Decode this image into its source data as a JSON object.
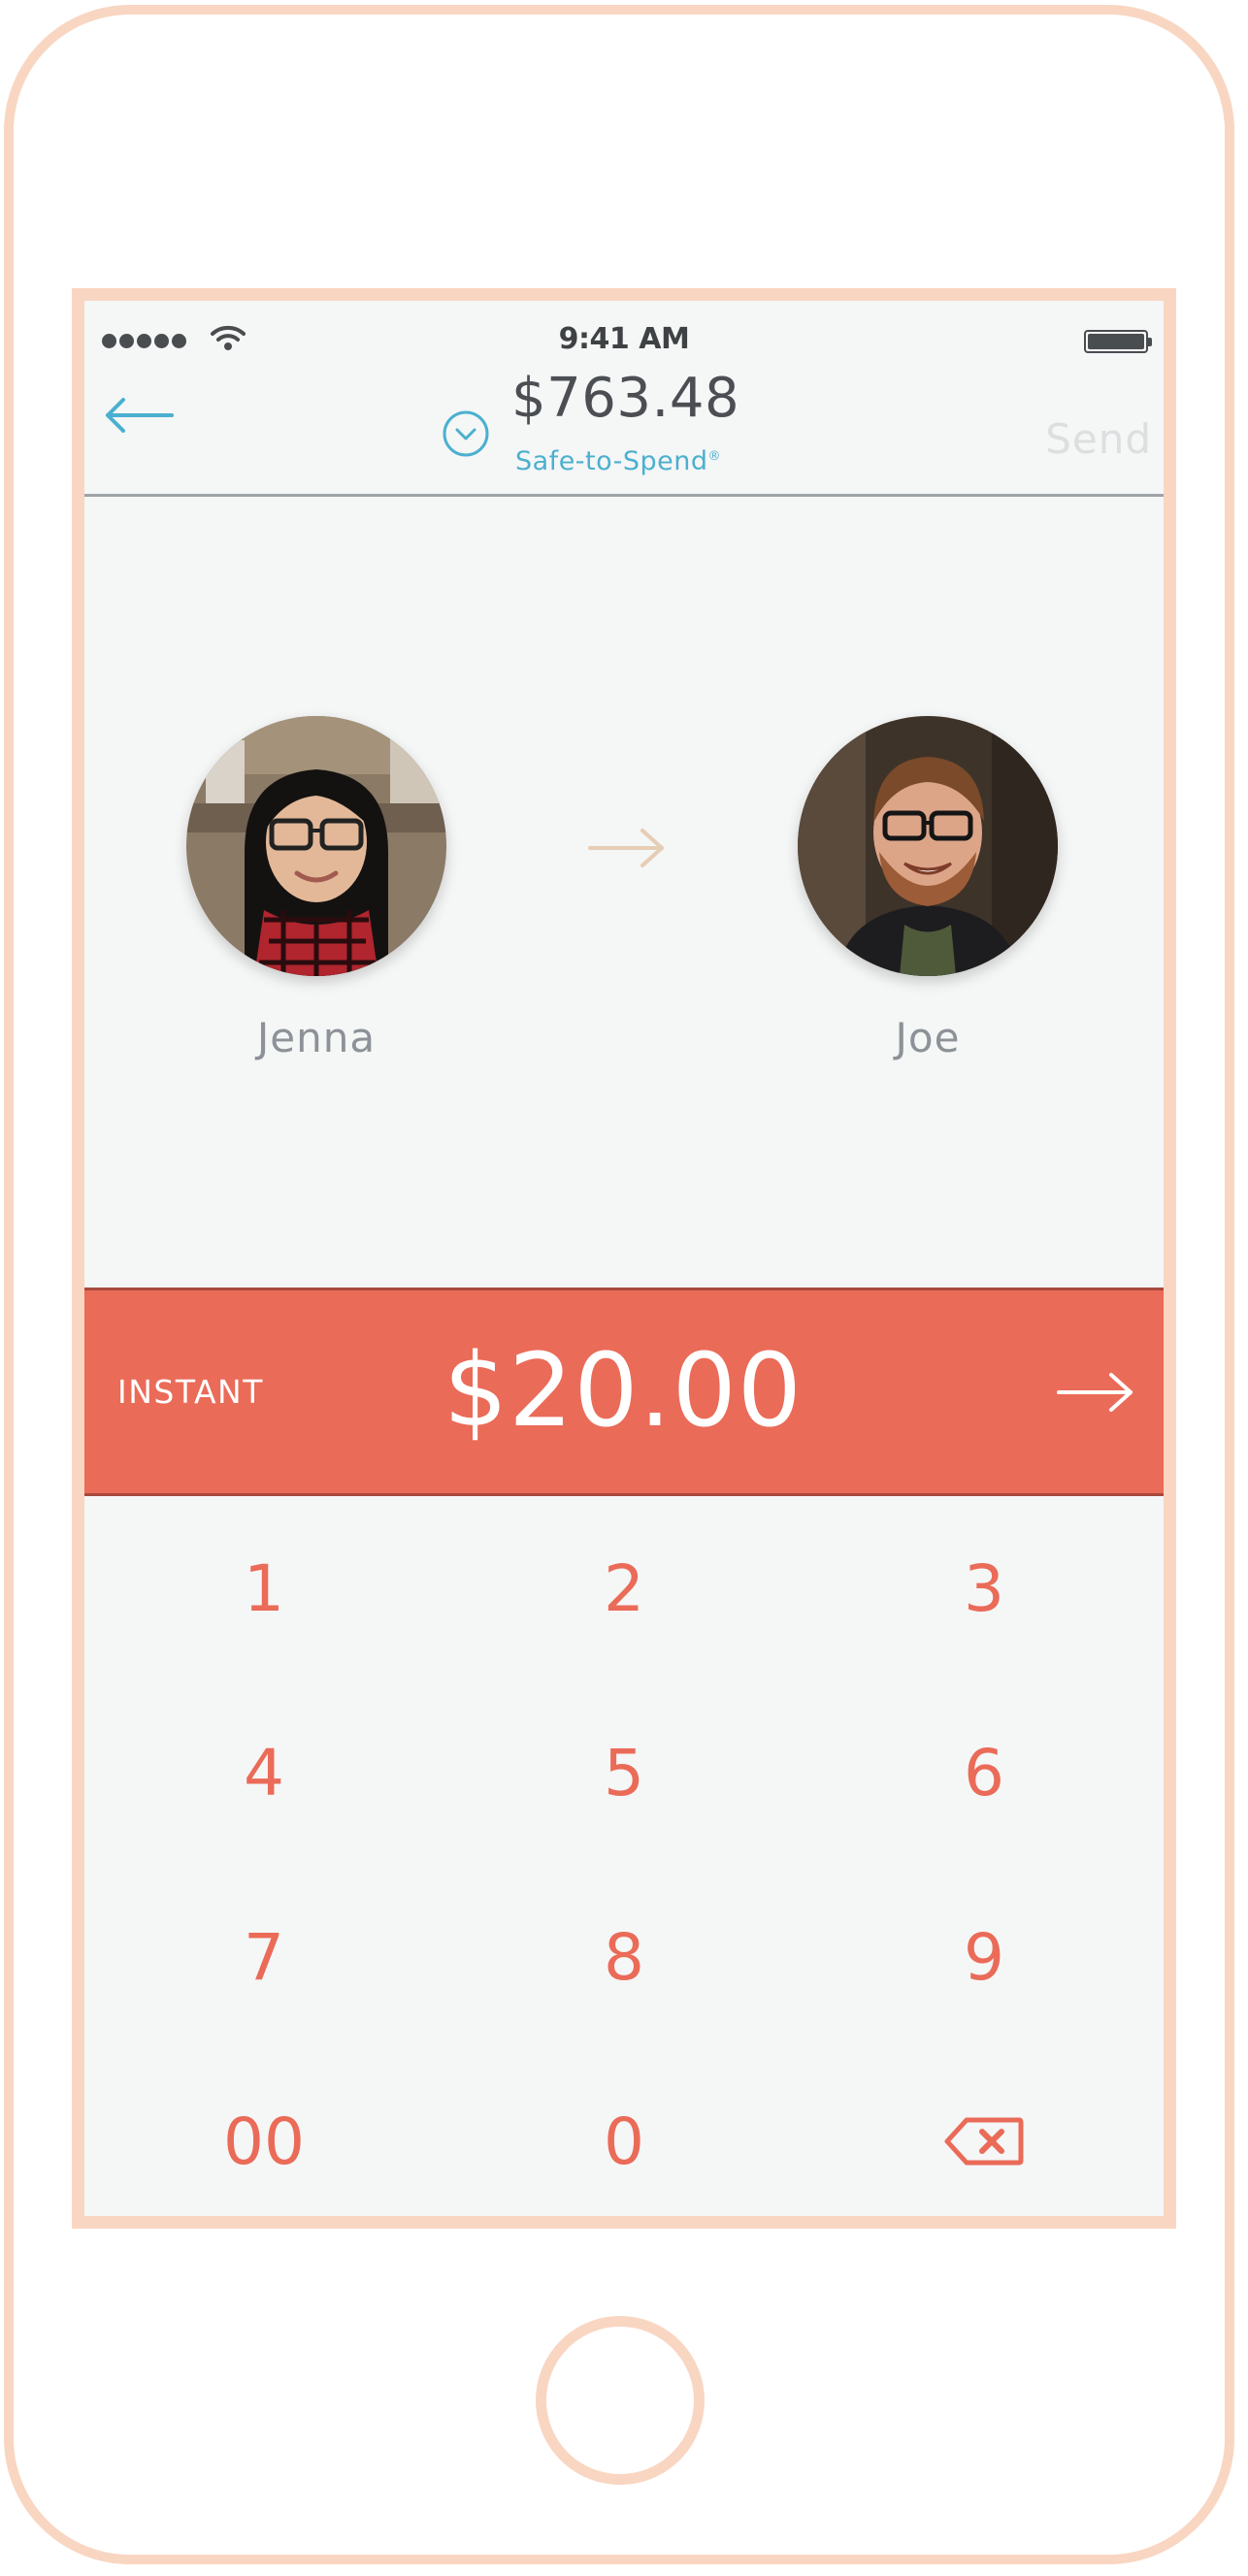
{
  "status_bar": {
    "time": "9:41 AM"
  },
  "nav": {
    "balance": "$763.48",
    "balance_label": "Safe-to-Spend",
    "balance_label_mark": "®",
    "send_label": "Send"
  },
  "transfer": {
    "sender": {
      "name": "Jenna"
    },
    "recipient": {
      "name": "Joe"
    }
  },
  "amount_bar": {
    "mode_label": "INSTANT",
    "amount": "$20.00"
  },
  "keypad": {
    "keys": [
      "1",
      "2",
      "3",
      "4",
      "5",
      "6",
      "7",
      "8",
      "9",
      "00",
      "0"
    ]
  },
  "icons": {
    "back": "arrow-left-icon",
    "balance_toggle": "chevron-down-circle-icon",
    "transfer": "arrow-right-icon",
    "confirm": "arrow-right-icon",
    "delete": "backspace-icon"
  },
  "colors": {
    "accent": "#ea6b58",
    "link": "#4bb0cf",
    "frame": "#f9d6c2",
    "background": "#f5f6f6"
  }
}
